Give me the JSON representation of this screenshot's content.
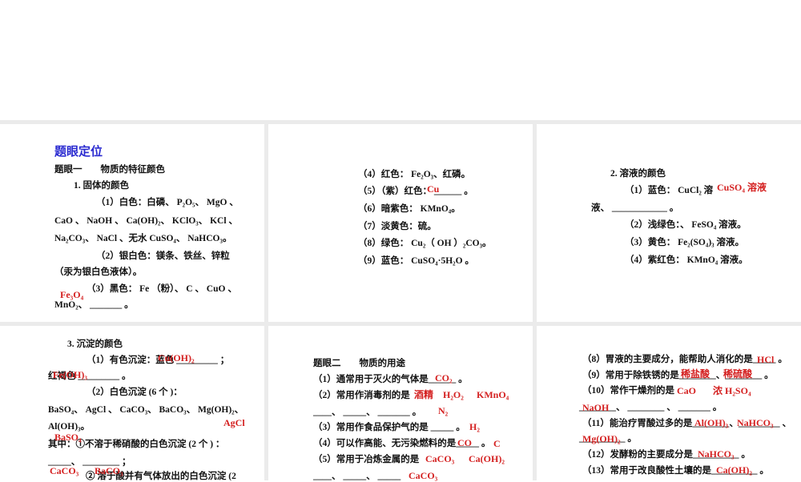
{
  "slides": [
    {
      "lines": [
        "题眼定位",
        "题眼一　　物质的特征颜色",
        "1. 固体的颜色",
        "（1）白色：白磷、 P₂O₅、 MgO 、",
        "CaO 、 NaOH 、 Ca(OH)₂、 KClO₃、 KCl 、",
        "Na₂CO₃、 NaCl 、无水 CuSO₄、 NaHCO₃。",
        "（2）银白色：镁条、铁丝、锌粒",
        "（汞为银白色液体）。",
        "（3）黑色： Fe （粉）、 C 、 CuO 、",
        "MnO₂、 _______ 。"
      ],
      "answers": [
        "Fe₃O₄"
      ]
    },
    {
      "lines": [
        "（4）红色： Fe₂O₃、红磷。",
        "（5）（紫）红色： ______ 。",
        "（6）暗紫色： KMnO₄。",
        "（7）淡黄色：硫。",
        "（8）绿色：  Cu₂（ OH ）₂CO₃。",
        "（9）蓝色： CuSO₄·5H₂O 。"
      ],
      "answers": [
        "Cu"
      ]
    },
    {
      "lines": [
        "2. 溶液的颜色",
        "（1）蓝色： CuCl₂ 溶",
        "液、 ____________ 。",
        "（2）浅绿色：、 FeSO₄ 溶液。",
        "（3）黄色： Fe₂(SO₄)₃ 溶液。",
        "（4）紫红色： KMnO₄ 溶液。"
      ],
      "answers": [
        "CuSO₄ 溶液"
      ]
    },
    {
      "lines": [
        "3. 沉淀的颜色",
        "（1）有色沉淀：蓝色 _________ ；",
        "红褐色 _________ 。",
        "（2）白色沉淀 (6 个 )：",
        "BaSO₄、 AgCl 、 CaCO₃、 BaCO₃、 Mg(OH)₂、",
        "Al(OH)₃。",
        "其中：①不溶于稀硝酸的白色沉淀 (2 个 ) ：",
        "_____、 ________ ；",
        "② 溶于酸并有气体放出的白色沉淀 (2"
      ],
      "answers": [
        "Cu(OH)₂",
        "Fe(OH)₃",
        "AgCl",
        "BaSO₄",
        "CaCO₃",
        "BaCO₃"
      ]
    },
    {
      "lines": [
        "题眼二　　物质的用途",
        "（1）通常用于灭火的气体是______ 。",
        "（2）常用作消毒剂的是",
        "____、 _____、 _______ 。",
        "（3）常用作食品保护气的是 _____ 。",
        "（4）可以作高能、无污染燃料的是_____ 。",
        "（5）常用于冶炼金属的是",
        "____、 _____、 _____"
      ],
      "answers": [
        "CO₂",
        "酒精",
        "H₂O₂",
        "KMnO₄",
        "N₂",
        "H₂",
        "CO",
        "C",
        "CaCO₃",
        "Ca(OH)₂",
        "CaCO₃"
      ]
    },
    {
      "lines": [
        "（8）胃液的主要成分，能帮助人消化的是_____ 。",
        "（9）常用于除铁锈的是________、________ 。",
        "（10）常作干燥剂的是",
        "________、 ________ 、 _______ 。",
        "（11）能治疗胃酸过多的是________、_________ 、",
        "__________ 。",
        "（12）发酵粉的主要成分是__________ 。",
        "（13）常用于改良酸性土壤的是__________ 。"
      ],
      "answers": [
        "HCl",
        "稀盐酸",
        "稀硫酸",
        "CaO",
        "浓 H₂SO₄",
        "NaOH",
        "Al(OH)₃",
        "NaHCO₃",
        "Mg(OH)₂",
        "NaHCO₃",
        "Ca(OH)₂"
      ]
    }
  ]
}
